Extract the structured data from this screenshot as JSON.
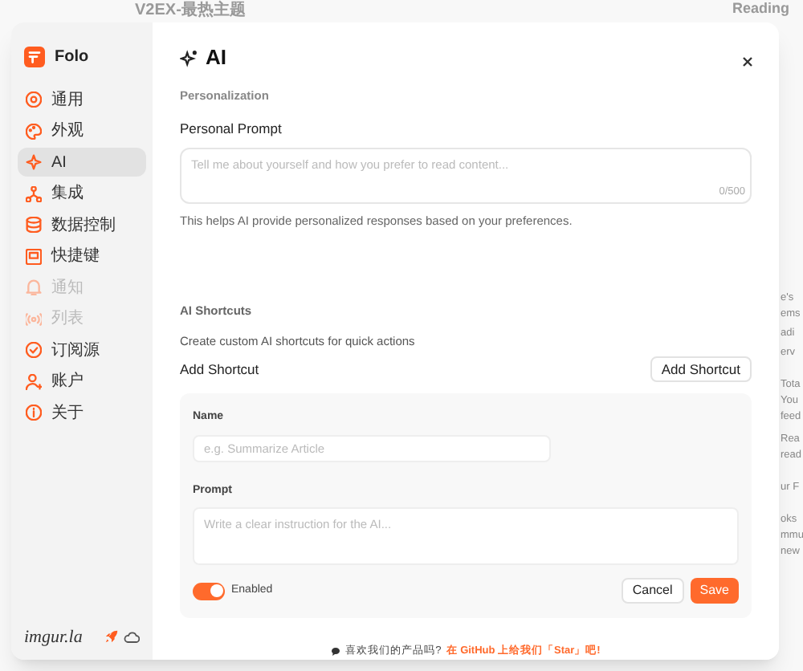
{
  "background": {
    "title": "V2EX-最热主题",
    "panel_title": "Reading",
    "fragments": [
      "e's",
      "ems",
      "adi",
      "erv",
      "Tota",
      "You",
      "feed",
      "Rea",
      "read",
      "ur F",
      "oks",
      "mmu",
      "new"
    ]
  },
  "sidebar": {
    "app_name": "Folo",
    "items": [
      {
        "label": "通用",
        "selected": false,
        "disabled": false
      },
      {
        "label": "外观",
        "selected": false,
        "disabled": false
      },
      {
        "label": "AI",
        "selected": true,
        "disabled": false
      },
      {
        "label": "集成",
        "selected": false,
        "disabled": false
      },
      {
        "label": "数据控制",
        "selected": false,
        "disabled": false
      },
      {
        "label": "快捷键",
        "selected": false,
        "disabled": false
      },
      {
        "label": "通知",
        "selected": false,
        "disabled": true
      },
      {
        "label": "列表",
        "selected": false,
        "disabled": true
      },
      {
        "label": "订阅源",
        "selected": false,
        "disabled": false
      },
      {
        "label": "账户",
        "selected": false,
        "disabled": false
      },
      {
        "label": "关于",
        "selected": false,
        "disabled": false
      }
    ],
    "footer_brand": "imgur.la"
  },
  "panel": {
    "title": "AI",
    "personalization": {
      "heading": "Personalization",
      "label": "Personal Prompt",
      "placeholder": "Tell me about yourself and how you prefer to read content...",
      "counter": "0/500",
      "help": "This helps AI provide personalized responses based on your preferences."
    },
    "shortcuts": {
      "heading": "AI Shortcuts",
      "description": "Create custom AI shortcuts for quick actions",
      "label": "Add Shortcut",
      "button": "Add Shortcut",
      "form": {
        "name_label": "Name",
        "name_placeholder": "e.g. Summarize Article",
        "prompt_label": "Prompt",
        "prompt_placeholder": "Write a clear instruction for the AI...",
        "enabled": true,
        "enabled_label": "Enabled",
        "cancel": "Cancel",
        "save": "Save"
      }
    },
    "footer": {
      "question": "喜欢我们的产品吗?",
      "link": "在 GitHub 上给我们「Star」吧!"
    }
  }
}
